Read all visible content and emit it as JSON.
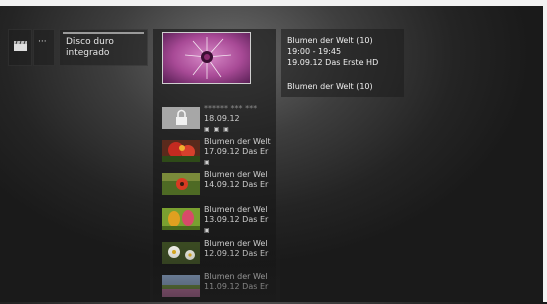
{
  "left_nav": {
    "more_label": "···",
    "disk_label_line1": "Disco duro",
    "disk_label_line2": "integrado"
  },
  "recordings": [
    {
      "title": "****** *** ***",
      "date": "18.09.12",
      "icons": "▣ ▣ ▣",
      "locked": true
    },
    {
      "title": "Blumen der Welt",
      "date": "17.09.12 Das Er",
      "icons": "▣",
      "locked": false
    },
    {
      "title": "Blumen der Wel",
      "date": "14.09.12 Das Er",
      "icons": "",
      "locked": false
    },
    {
      "title": "Blumen der Wel",
      "date": "13.09.12 Das Er",
      "icons": "▣",
      "locked": false
    },
    {
      "title": "Blumen der Wel",
      "date": "12.09.12 Das Er",
      "icons": "",
      "locked": false
    },
    {
      "title": "Blumen der Wel",
      "date": "11.09.12 Das Er",
      "icons": "",
      "locked": false
    }
  ],
  "info": {
    "title": "Blumen der Welt (10)",
    "time": "19:00 - 19:45",
    "date_channel": "19.09.12  Das Erste HD",
    "title_repeat": "Blumen der Welt (10)"
  }
}
